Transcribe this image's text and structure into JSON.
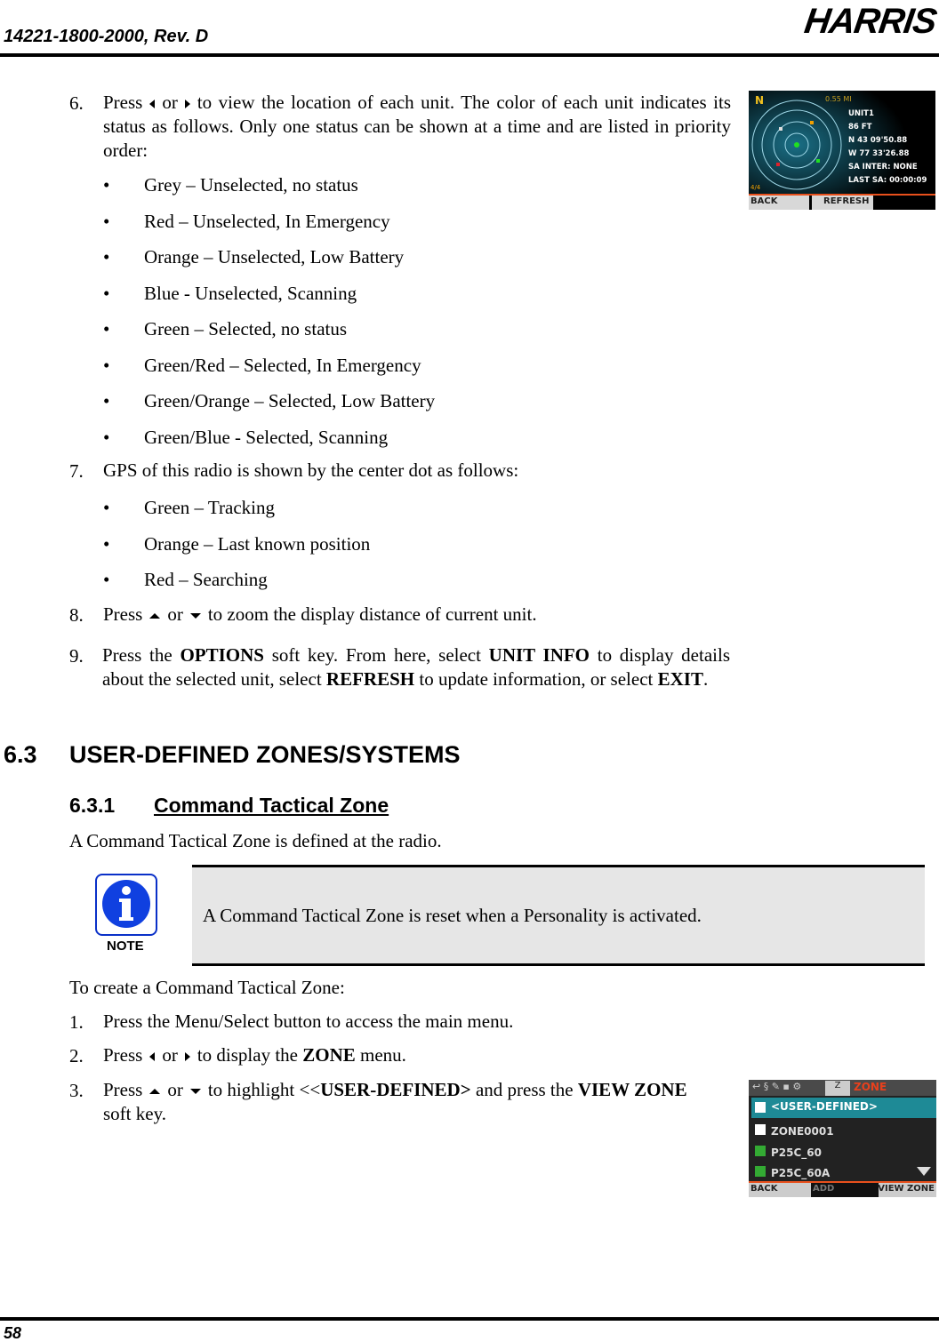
{
  "header": {
    "doc_number": "14221-1800-2000, Rev. D",
    "logo": "HARRIS"
  },
  "footer": {
    "page_number": "58"
  },
  "steps_a": [
    {
      "num": "6.",
      "parts": [
        "Press",
        "or",
        "to view the location of each unit. The color of each unit indicates its status as follows. Only one status can be shown at a time and are listed in priority order:"
      ]
    },
    {
      "num": "7.",
      "text": "GPS of this radio is shown by the center dot as follows:"
    },
    {
      "num": "8.",
      "parts": [
        "Press",
        "or",
        "to zoom the display distance of current unit."
      ]
    },
    {
      "num": "9.",
      "parts": [
        "Press the",
        "OPTIONS",
        "soft key.",
        "From here, select",
        "UNIT INFO",
        "to display details about the selected unit, select",
        "REFRESH",
        "to update information, or select",
        "EXIT",
        "."
      ]
    }
  ],
  "status_bullets": [
    "Grey – Unselected, no status",
    "Red – Unselected, In Emergency",
    "Orange – Unselected, Low Battery",
    "Blue - Unselected, Scanning",
    "Green – Selected, no status",
    "Green/Red – Selected, In Emergency",
    "Green/Orange – Selected, Low Battery",
    "Green/Blue - Selected, Scanning"
  ],
  "gps_bullets": [
    "Green – Tracking",
    "Orange – Last known position",
    "Red – Searching"
  ],
  "section": {
    "number": "6.3",
    "title": "USER-DEFINED ZONES/SYSTEMS"
  },
  "subsection": {
    "number": "6.3.1",
    "title": "Command Tactical Zone"
  },
  "intro": "A Command Tactical Zone is defined at the radio.",
  "note": {
    "label": "NOTE",
    "text": "A Command Tactical Zone is reset when a Personality is activated."
  },
  "create_intro": "To create a Command Tactical Zone:",
  "steps_b": [
    {
      "num": "1.",
      "text": "Press the Menu/Select button to access the main menu."
    },
    {
      "num": "2.",
      "parts": [
        "Press",
        "or",
        "to display the",
        "ZONE",
        "menu."
      ]
    },
    {
      "num": "3.",
      "parts": [
        "Press",
        "or",
        "to highlight <",
        "USER-DEFINED>",
        "and press the",
        "VIEW ZONE",
        "soft key."
      ]
    }
  ],
  "screen_map": {
    "north": "N",
    "distance": "0.55 MI",
    "page": "4/4",
    "info": [
      "UNIT1",
      "86 FT",
      "N 43 09'50.88",
      "W 77 33'26.88",
      "SA INTER: NONE",
      "LAST SA: 00:00:09"
    ],
    "softkeys": [
      "BACK",
      "REFRESH"
    ],
    "colors": {
      "grey": "#dddddd",
      "red": "#e0202a",
      "orange": "#f0a000",
      "green": "#20e020",
      "ring": "#9fd8e8",
      "bg": "#0a2a3a"
    }
  },
  "screen_zone": {
    "tab": "ZONE",
    "items": [
      "<USER-DEFINED>",
      "ZONE0001",
      "P25C_60",
      "P25C_60A"
    ],
    "softkeys": [
      "BACK",
      "ADD",
      "VIEW ZONE"
    ],
    "colors": {
      "highlight": "#1e8a96",
      "tab": "#e8401c",
      "accent": "#e8501c"
    }
  }
}
